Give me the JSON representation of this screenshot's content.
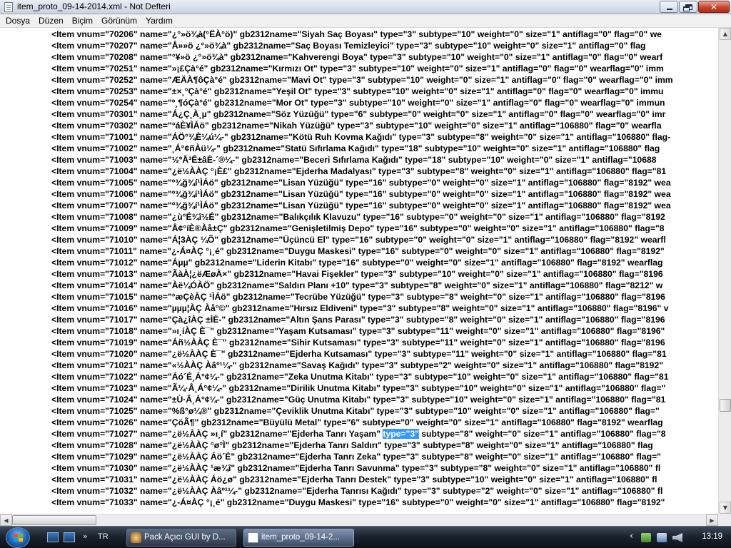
{
  "window": {
    "title": "item_proto_09-14-2014.xml - Not Defteri",
    "close_glyph": "✕"
  },
  "menu": [
    "Dosya",
    "Düzen",
    "Biçim",
    "Görünüm",
    "Yardım"
  ],
  "lines": [
    "<Item vnum=\"70206\" name=\"¿°»ö¾à(°ËÀ°ö)\" gb2312name=\"Siyah Saç Boyası\" type=\"3\" subtype=\"10\" weight=\"0\" size=\"1\" antiflag=\"0\" flag=\"0\" we",
    "<Item vnum=\"70207\" name=\"Å»»ö ¿°»ö¾à\" gb2312name=\"Saç Boyası Temizleyici\" type=\"3\" subtype=\"10\" weight=\"0\" size=\"1\" antiflag=\"0\" flag",
    "<Item vnum=\"70208\" name=\"°¥»ö ¿°»ö¾à\" gb2312name=\"Kahverengi Boya\" type=\"3\" subtype=\"10\" weight=\"0\" size=\"1\" antiflag=\"0\" flag=\"0\" wearf",
    "<Item vnum=\"70251\" name=\"»¡£Çà°é\" gb2312name=\"Kırmızı Ot\" type=\"3\" subtype=\"10\" weight=\"0\" size=\"1\" antiflag=\"0\" flag=\"0\" wearflag=\"0\" imm",
    "<Item vnum=\"70252\" name=\"ÆÄÀ¶ôÇà°é\" gb2312name=\"Mavi Ot\" type=\"3\" subtype=\"10\" weight=\"0\" size=\"1\" antiflag=\"0\" flag=\"0\" wearflag=\"0\" imm",
    "<Item vnum=\"70253\" name=\"±×¸°Çà°é\" gb2312name=\"Yeşil Ot\" type=\"3\" subtype=\"10\" weight=\"0\" size=\"1\" antiflag=\"0\" flag=\"0\" wearflag=\"0\" immu",
    "<Item vnum=\"70254\" name=\"º¸¶óÇà°é\" gb2312name=\"Mor Ot\" type=\"3\" subtype=\"10\" weight=\"0\" size=\"1\" antiflag=\"0\" flag=\"0\" wearflag=\"0\" immun",
    "<Item vnum=\"70301\" name=\"Á¿Ç¸À¸µ\" gb2312name=\"Söz Yüzüğü\" type=\"6\" subtype=\"0\" weight=\"0\" size=\"1\" antiflag=\"0\" flag=\"0\" wearflag=\"0\" imr",
    "<Item vnum=\"70302\" name=\"°áÈ¥ÌÁö\" gb2312name=\"Nikah Yüzüğü\" type=\"3\" subtype=\"10\" weight=\"0\" size=\"1\" antiflag=\"106880\" flag=\"0\" wearfla",
    "<Item vnum=\"71001\" name=\"ÁÖ°¾È¼ú¼-\" gb2312name=\"Kötü Ruh Kovma Kağıdı\" type=\"3\" subtype=\"8\" weight=\"0\" size=\"1\" antiflag=\"106880\" flag-",
    "<Item vnum=\"71002\" name=\"¸Á°¢ñÀü¼-\" gb2312name=\"Statü Sıfırlama Kağıdı\" type=\"18\" subtype=\"10\" weight=\"0\" size=\"1\" antiflag=\"106880\" flag",
    "<Item vnum=\"71003\" name=\"½ºÅ³Ê±âÈ-´®¼-\" gb2312name=\"Beceri Sıfırlama Kağıdı\" type=\"18\" subtype=\"10\" weight=\"0\" size=\"1\" antiflag=\"10688",
    "<Item vnum=\"71004\" name=\"¿ë½ÀÀÇ °¡È£\" gb2312name=\"Ejderha Madalyası\" type=\"3\" subtype=\"8\" weight=\"0\" size=\"1\" antiflag=\"106880\" flag=\"81",
    "<Item vnum=\"71005\" name=\"º¾ğ¾í¹ÌÁö\" gb2312name=\"Lisan Yüzüğü\" type=\"16\" subtype=\"0\" weight=\"0\" size=\"1\" antiflag=\"106880\" flag=\"8192\" wea",
    "<Item vnum=\"71006\" name=\"º¾ğ¾í¹ÌÁö\" gb2312name=\"Lisan Yüzüğü\" type=\"16\" subtype=\"0\" weight=\"0\" size=\"1\" antiflag=\"106880\" flag=\"8192\" wea",
    "<Item vnum=\"71007\" name=\"º¾ğ¾í¹ÌÁö\" gb2312name=\"Lisan Yüzüğü\" type=\"16\" subtype=\"0\" weight=\"0\" size=\"1\" antiflag=\"106880\" flag=\"8192\" wea",
    "<Item vnum=\"71008\" name=\"¿ù°É¾î½É\" gb2312name=\"Balıkçılık Klavuzu\" type=\"16\" subtype=\"0\" weight=\"0\" size=\"1\" antiflag=\"106880\" flag=\"8192",
    "<Item vnum=\"71009\" name=\"Å¢°íÈ®Àå±Ç\" gb2312name=\"Genişletilmiş Depo\" type=\"16\" subtype=\"0\" weight=\"0\" size=\"1\" antiflag=\"106880\" flag=\"8",
    "<Item vnum=\"71010\" name=\"Á¦3ÀÇ ¼Õ\" gb2312name=\"Üçüncü El\" type=\"16\" subtype=\"0\" weight=\"0\" size=\"1\" antiflag=\"106880\" flag=\"8192\" wearfl",
    "<Item vnum=\"71011\" name=\"¿-Á¤ÀÇ °¡¸é\" gb2312name=\"Duygu Maskesi\" type=\"16\" subtype=\"0\" weight=\"0\" size=\"1\" antiflag=\"106880\" flag=\"8192\" ",
    "<Item vnum=\"71012\" name=\"Áµµ\" gb2312name=\"Liderin Kitabı\" type=\"16\" subtype=\"0\" weight=\"0\" size=\"1\" antiflag=\"106880\" flag=\"8192\" wearflag",
    "<Item vnum=\"71013\" name=\"ÃàÀ¦¿ëÆøÀ×\" gb2312name=\"Havai Fişekler\" type=\"3\" subtype=\"10\" weight=\"0\" size=\"1\" antiflag=\"106880\" flag=\"8196",
    "<Item vnum=\"71014\" name=\"Àë¼ÓÀÖ\" gb2312name=\"Saldırı Planı +10\" type=\"3\" subtype=\"8\" weight=\"0\" size=\"1\" antiflag=\"106880\" flag=\"8212\" w",
    "<Item vnum=\"71015\" name=\"°æÇèÀÇ ¹ÌÁö\" gb2312name=\"Tecrübe Yüzüğü\" type=\"3\" subtype=\"8\" weight=\"0\" size=\"1\" antiflag=\"106880\" flag=\"8196",
    "<Item vnum=\"71016\" name=\"µµµ¦ÀÇ Àå°©\" gb2312name=\"Hırsız Eldiveni\" type=\"3\" subtype=\"8\" weight=\"0\" size=\"1\" antiflag=\"106880\" flag=\"8196\" v",
    "<Item vnum=\"71017\" name=\"Çà¿îÀÇ ±ÌÈ-\" gb2312name=\"Altın Şans Parası\" type=\"3\" subtype=\"8\" weight=\"0\" size=\"1\" antiflag=\"106880\" flag=\"8196",
    "<Item vnum=\"71018\" name=\"»ı¸íÀÇ È¯\" gb2312name=\"Yaşam Kutsaması\" type=\"3\" subtype=\"11\" weight=\"0\" size=\"1\" antiflag=\"106880\" flag=\"8196\"",
    "<Item vnum=\"71019\" name=\"Áñ½ÀÀÇ È¯\" gb2312name=\"Sihir Kutsaması\" type=\"3\" subtype=\"11\" weight=\"0\" size=\"1\" antiflag=\"106880\" flag=\"8196",
    "<Item vnum=\"71020\" name=\"¿ë½ÀÀÇ È¯\" gb2312name=\"Ejderha Kutsaması\" type=\"3\" subtype=\"11\" weight=\"0\" size=\"1\" antiflag=\"106880\" flag=\"81",
    "<Item vnum=\"71021\" name=\"«½ÀÀÇ Àâº¹¼-\" gb2312name=\"Savaş Kağıdı\" type=\"3\" subtype=\"2\" weight=\"0\" size=\"1\" antiflag=\"106880\" flag=\"8192\"",
    "<Item vnum=\"71022\" name=\"Áó´É¸Á°¢¼-\" gb2312name=\"Zeka Unutma Kitabı\" type=\"3\" subtype=\"10\" weight=\"0\" size=\"1\" antiflag=\"106880\" flag=\"81",
    "<Item vnum=\"71023\" name=\"Ã¼·Â¸Á°¢¼-\" gb2312name=\"Dirilik Unutma Kitabı\" type=\"3\" subtype=\"10\" weight=\"0\" size=\"1\" antiflag=\"106880\" flag=\"",
    "<Item vnum=\"71024\" name=\"±Ù·Â¸Á°¢¼-\" gb2312name=\"Güç Unutma Kitabı\" type=\"3\" subtype=\"10\" weight=\"0\" size=\"1\" antiflag=\"106880\" flag=\"81",
    "<Item vnum=\"71025\" name=\"%ß°ø¼®\" gb2312name=\"Çeviklik Unutma Kitabı\" type=\"3\" subtype=\"10\" weight=\"0\" size=\"1\" antiflag=\"106880\" flag=\"",
    "<Item vnum=\"71026\" name=\"ÇöÃ¶\" gb2312name=\"Büyülü Metal\" type=\"6\" subtype=\"0\" weight=\"0\" size=\"1\" antiflag=\"106880\" flag=\"8192\" wearflag",
    "<Item vnum=\"71028\" name=\"¿ë½ÀÀÇ °ø°Ì\" gb2312name=\"Ejderha Tanrı Saldırı\" type=\"3\" subtype=\"8\" weight=\"0\" size=\"1\" antiflag=\"106880\" flag",
    "<Item vnum=\"71029\" name=\"¿ë½ÀÀÇ Áö´É\" gb2312name=\"Ejderha Tanrı Zeka\" type=\"3\" subtype=\"8\" weight=\"0\" size=\"1\" antiflag=\"106880\" flag=\"",
    "<Item vnum=\"71030\" name=\"¿ë½ÀÀÇ ¹æ¾î\" gb2312name=\"Ejderha Tanrı Savunma\" type=\"3\" subtype=\"8\" weight=\"0\" size=\"1\" antiflag=\"106880\" fl",
    "<Item vnum=\"71031\" name=\"¿ë½ÀÀÇ Áö¿ø\" gb2312name=\"Ejderha Tanrı Destek\" type=\"3\" subtype=\"10\" weight=\"0\" size=\"1\" antiflag=\"106880\" fl",
    "<Item vnum=\"71032\" name=\"¿ë½ÀÀÇ Àâº¹¼-\" gb2312name=\"Ejderha Tanrısı Kağıdı\" type=\"3\" subtype=\"2\" weight=\"0\" size=\"1\" antiflag=\"106880\" fl",
    "<Item vnum=\"71033\" name=\"¿-Á¤ÀÇ °¡¸é\" gb2312name=\"Duygu Maskesi\" type=\"16\" subtype=\"0\" weight=\"0\" size=\"1\" antiflag=\"106880\" flag=\"8192\" "
  ],
  "selected_line": {
    "before": "<Item vnum=\"71027\" name=\"¿ë½ÀÀÇ »ı¸í\" gb2312name=\"Ejderha Tanrı Yaşam\" ",
    "selected": "type=\"3\"",
    "after": " subtype=\"8\" weight=\"0\" size=\"1\" antiflag=\"106880\" flag=\"8"
  },
  "taskbar": {
    "quicklaunch_more": "»",
    "language": "TR",
    "tasks": [
      {
        "label": "Pack Açıcı GUI by D...",
        "active": false
      },
      {
        "label": "item_proto_09-14-2...",
        "active": true
      }
    ],
    "clock": "13:19",
    "tray_more": "‹"
  },
  "icons": {
    "start": "windows-start-orb",
    "quicklaunch": [
      "show-desktop-icon",
      "switch-windows-icon"
    ],
    "tray": [
      "network-shield-icon",
      "network-icon",
      "volume-icon"
    ]
  },
  "scrollbar_glyphs": {
    "up": "▲",
    "down": "▼",
    "left": "◀",
    "right": "▶"
  },
  "vertical_scroll_position": 0.8
}
